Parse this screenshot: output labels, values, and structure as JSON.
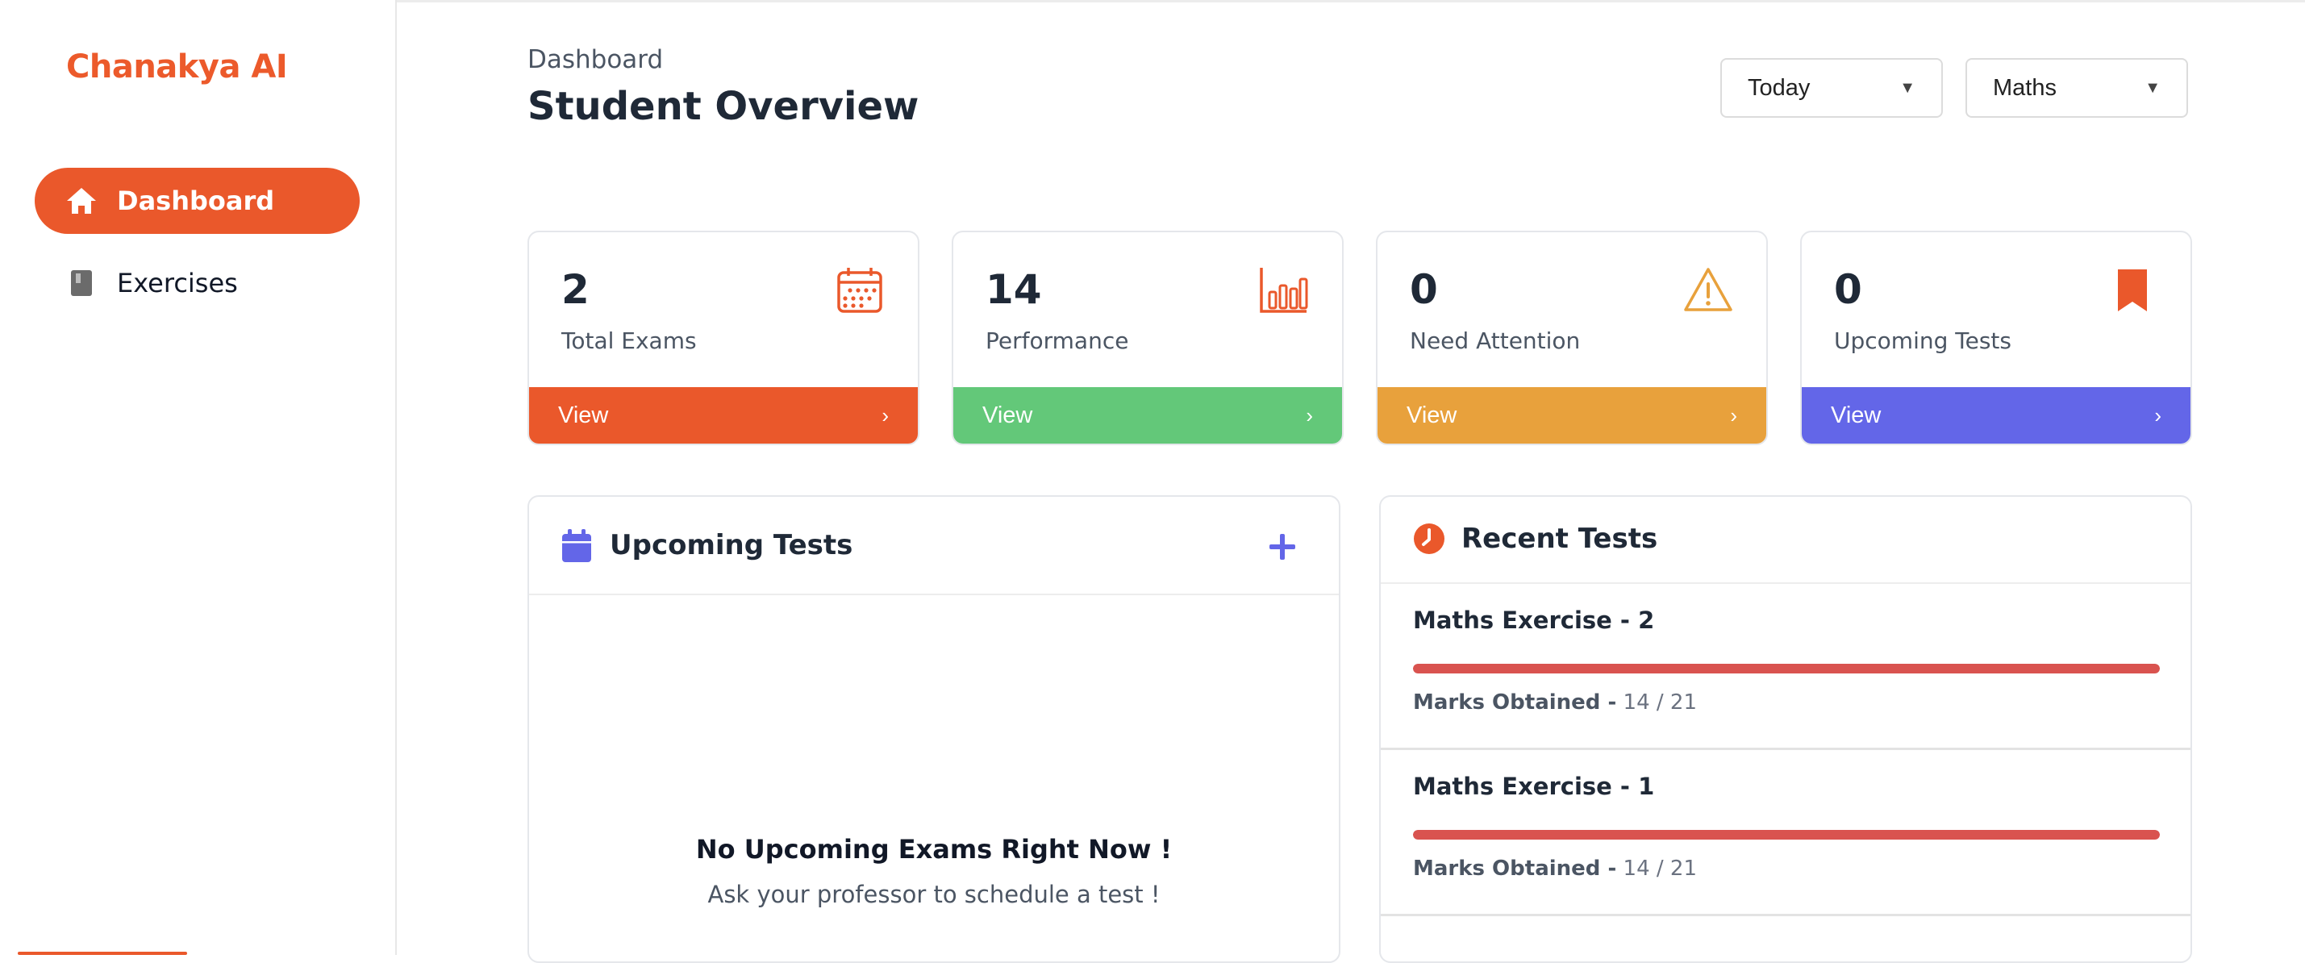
{
  "app": {
    "logo_text": "Chanakya AI",
    "accent_color": "#ea582b"
  },
  "sidebar": {
    "items": [
      {
        "label": "Dashboard",
        "icon": "home-icon",
        "active": true
      },
      {
        "label": "Exercises",
        "icon": "book-icon",
        "active": false
      }
    ]
  },
  "header": {
    "breadcrumb": "Dashboard",
    "title": "Student Overview",
    "filters": [
      {
        "value": "Today",
        "icon": "caret-down-icon"
      },
      {
        "value": "Maths",
        "icon": "caret-down-icon"
      }
    ]
  },
  "stats": [
    {
      "value": "2",
      "label": "Total Exams",
      "icon": "calendar-icon",
      "color": "#ea582b",
      "action": "View",
      "chevron": "›"
    },
    {
      "value": "14",
      "label": "Performance",
      "icon": "bar-chart-icon",
      "color": "#63c879",
      "action": "View",
      "chevron": "›"
    },
    {
      "value": "0",
      "label": "Need Attention",
      "icon": "warning-icon",
      "color": "#e8a13c",
      "action": "View",
      "chevron": "›"
    },
    {
      "value": "0",
      "label": "Upcoming Tests",
      "icon": "bookmark-icon",
      "color": "#6366e8",
      "action": "View",
      "chevron": "›"
    }
  ],
  "upcoming": {
    "title": "Upcoming Tests",
    "add_icon": "plus-icon",
    "empty_title": "No Upcoming Exams Right Now !",
    "empty_subtitle": "Ask your professor to schedule a test !"
  },
  "recent": {
    "title": "Recent Tests",
    "icon": "clock-icon",
    "tests": [
      {
        "name": "Maths Exercise - 2",
        "marks_label": "Marks Obtained -",
        "marks": "14 / 21",
        "progress": 1.0
      },
      {
        "name": "Maths Exercise - 1",
        "marks_label": "Marks Obtained -",
        "marks": "14 / 21",
        "progress": 1.0
      }
    ]
  }
}
